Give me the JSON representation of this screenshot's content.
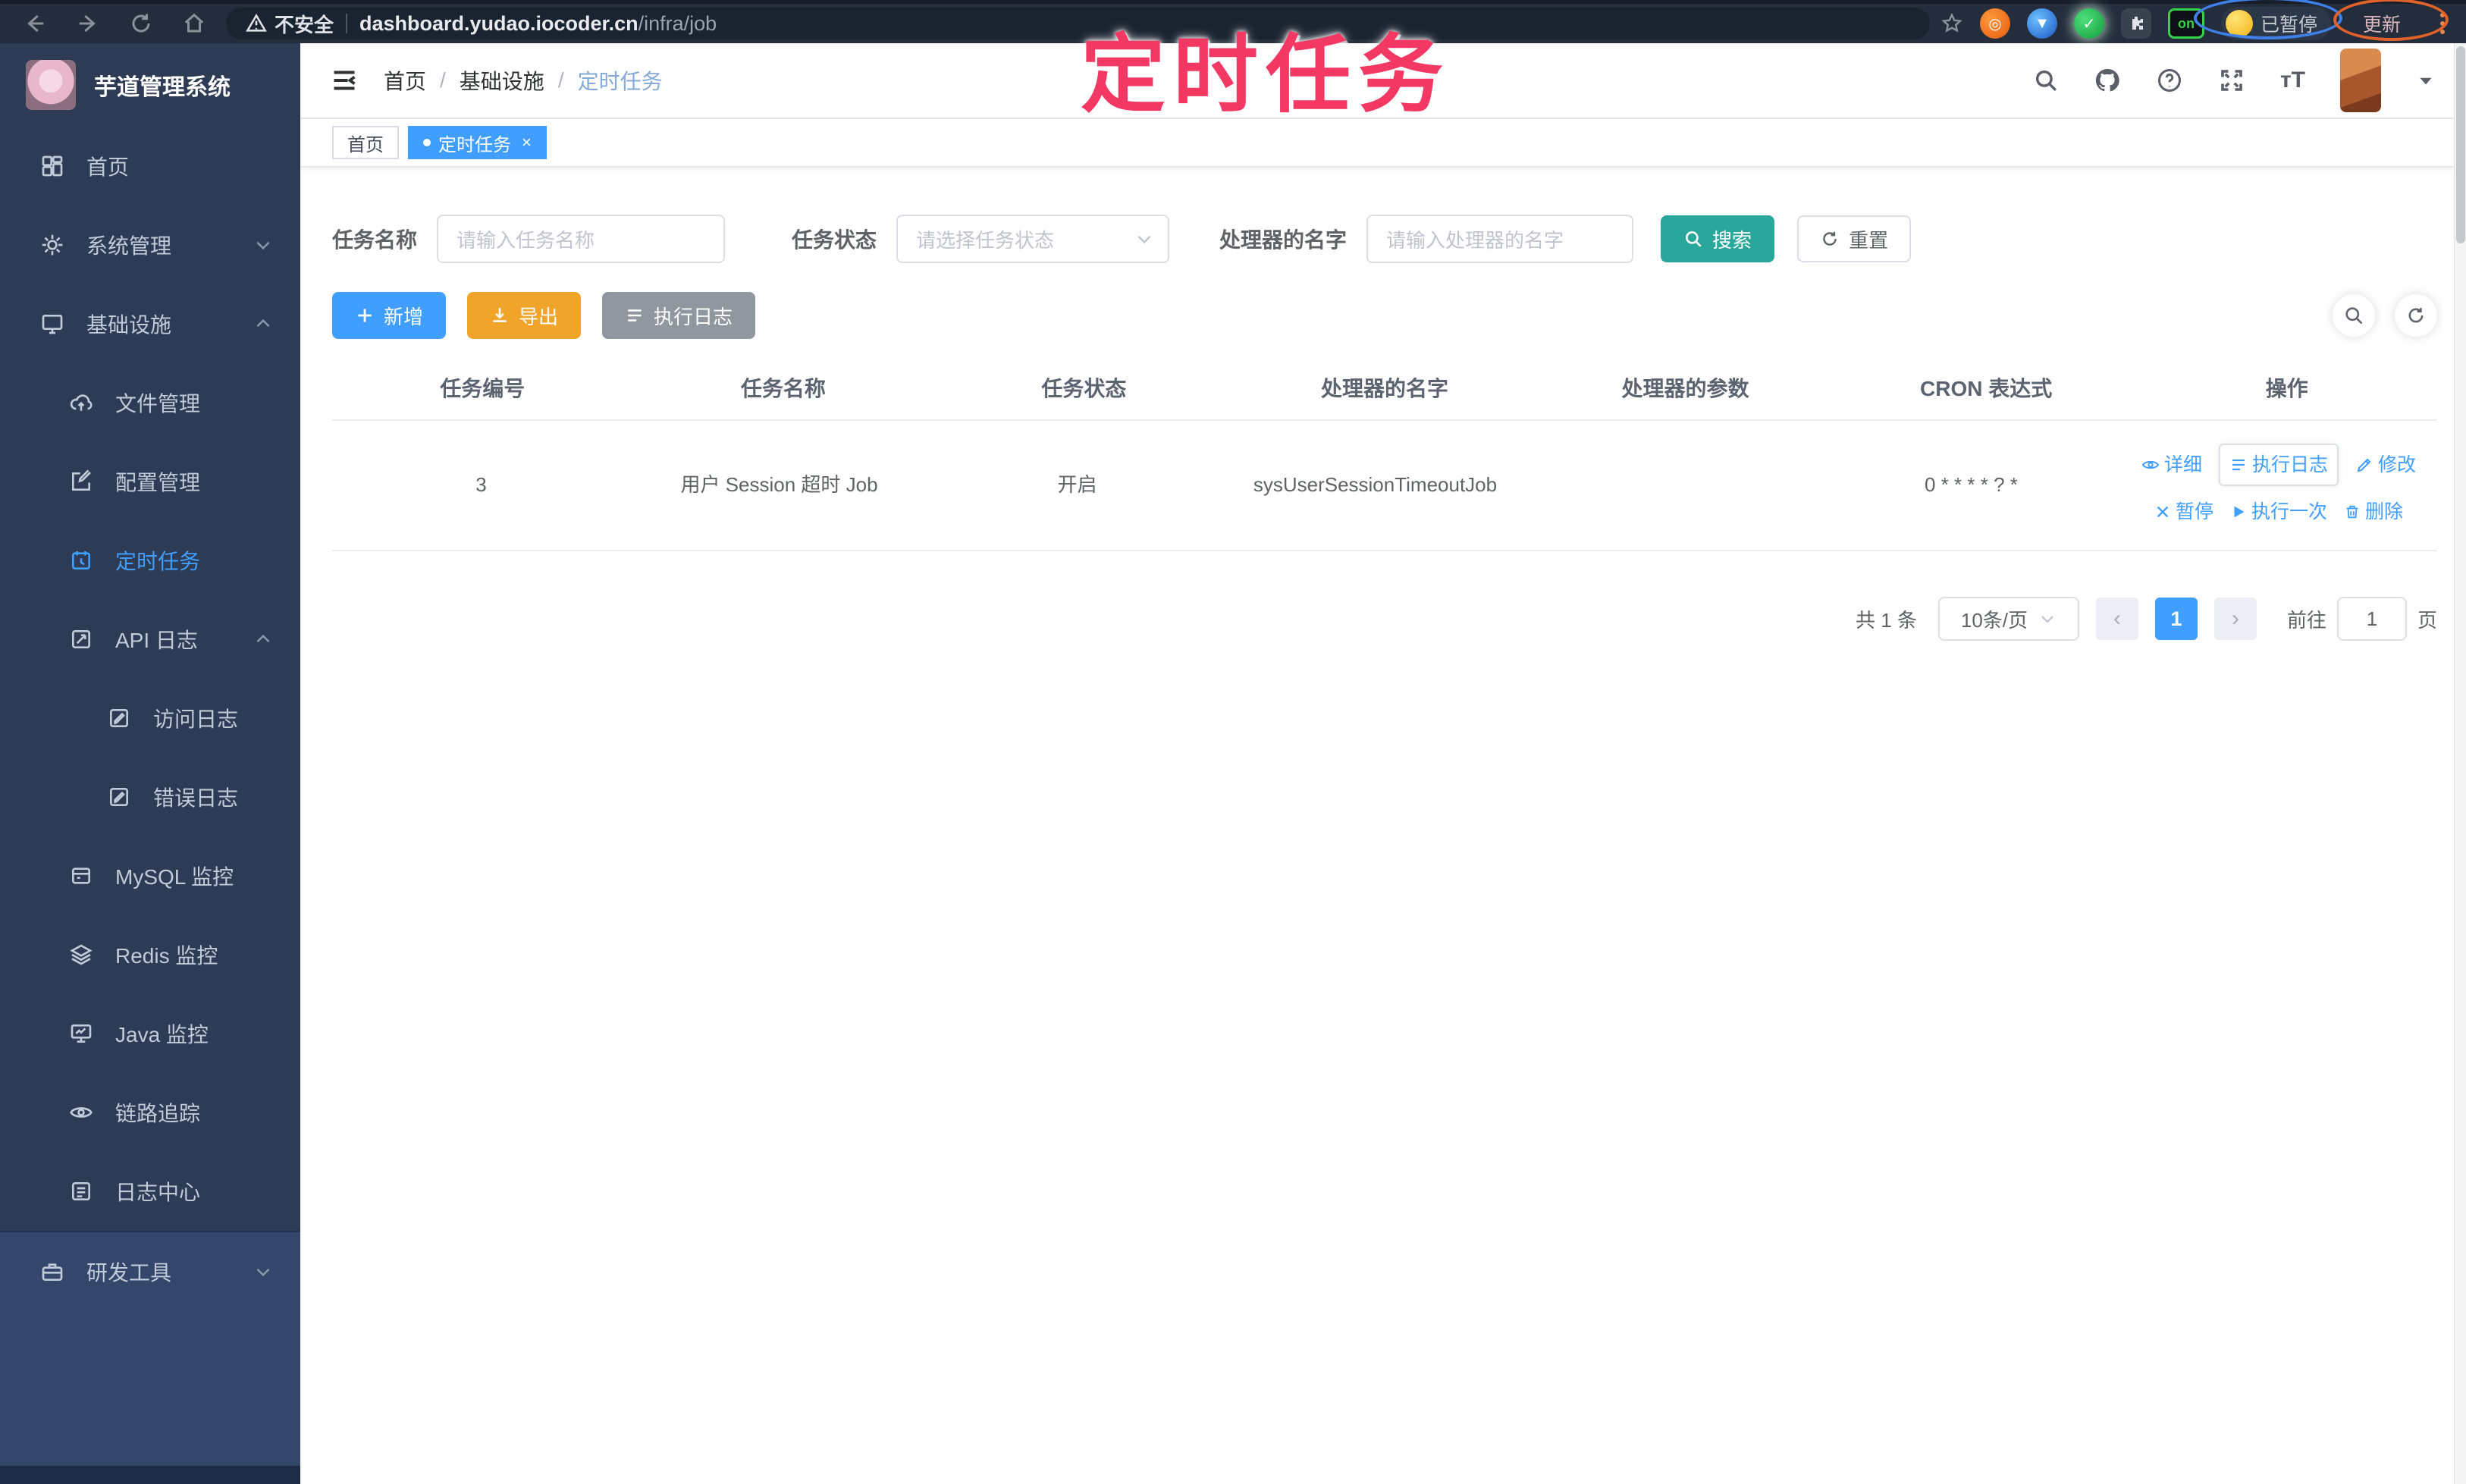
{
  "browser": {
    "security_label": "不安全",
    "url_domain": "dashboard.yudao.iocoder.cn",
    "url_path": "/infra/job",
    "extension_on_badge": "on",
    "profile_chip_label": "已暂停",
    "update_button_label": "更新"
  },
  "annotation": {
    "title": "定时任务"
  },
  "sidebar": {
    "app_title": "芋道管理系统",
    "items": [
      {
        "label": "首页"
      },
      {
        "label": "系统管理"
      },
      {
        "label": "基础设施"
      },
      {
        "label": "文件管理"
      },
      {
        "label": "配置管理"
      },
      {
        "label": "定时任务"
      },
      {
        "label": "API 日志"
      },
      {
        "label": "访问日志"
      },
      {
        "label": "错误日志"
      },
      {
        "label": "MySQL 监控"
      },
      {
        "label": "Redis 监控"
      },
      {
        "label": "Java 监控"
      },
      {
        "label": "链路追踪"
      },
      {
        "label": "日志中心"
      },
      {
        "label": "研发工具"
      }
    ]
  },
  "header": {
    "breadcrumb": {
      "home": "首页",
      "section": "基础设施",
      "current": "定时任务"
    }
  },
  "tags": {
    "home": "首页",
    "active": "定时任务",
    "close": "×"
  },
  "filter": {
    "fields": [
      {
        "label": "任务名称",
        "placeholder": "请输入任务名称"
      },
      {
        "label": "任务状态",
        "placeholder": "请选择任务状态"
      },
      {
        "label": "处理器的名字",
        "placeholder": "请输入处理器的名字"
      }
    ],
    "search_label": "搜索",
    "reset_label": "重置"
  },
  "toolbar": {
    "add_label": "新增",
    "export_label": "导出",
    "exec_log_label": "执行日志"
  },
  "table": {
    "headers": [
      "任务编号",
      "任务名称",
      "任务状态",
      "处理器的名字",
      "处理器的参数",
      "CRON 表达式",
      "操作"
    ],
    "rows": [
      {
        "id": "3",
        "name": "用户 Session 超时 Job",
        "status": "开启",
        "handler": "sysUserSessionTimeoutJob",
        "param": "",
        "cron": "0 * * * * ? *"
      }
    ],
    "actions": {
      "detail": "详细",
      "exec_log": "执行日志",
      "edit": "修改",
      "pause": "暂停",
      "run_once": "执行一次",
      "delete": "删除"
    }
  },
  "pagination": {
    "total": "共 1 条",
    "page_size": "10条/页",
    "current_page": "1",
    "goto_label": "前往",
    "goto_value": "1",
    "page_suffix": "页"
  },
  "colors": {
    "accent": "#409EFF",
    "search_teal": "#2aa79b",
    "export_orange": "#f0a52a",
    "info_gray": "#90979e",
    "sidebar_bg": "#2d3b55",
    "annotation_pink": "#f4386e"
  }
}
